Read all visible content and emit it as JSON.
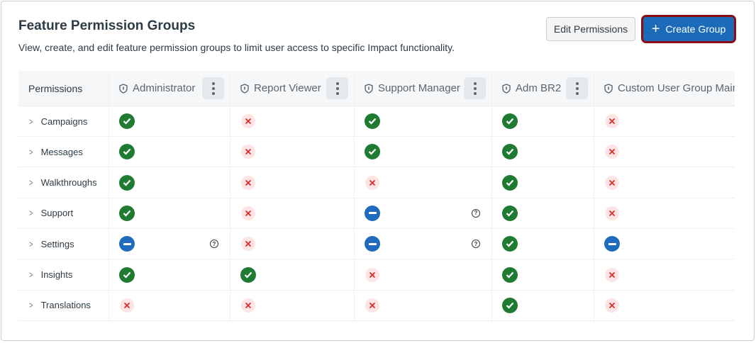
{
  "header": {
    "title": "Feature Permission Groups",
    "description": "View, create, and edit feature permission groups to limit user access to specific Impact functionality.",
    "edit_label": "Edit Permissions",
    "create_label": "Create Group",
    "create_icon": "+"
  },
  "table": {
    "first_header": "Permissions",
    "groups": [
      {
        "name": "Administrator",
        "menu": true
      },
      {
        "name": "Report Viewer",
        "menu": true
      },
      {
        "name": "Support Manager",
        "menu": true
      },
      {
        "name": "Adm BR2",
        "menu": true
      },
      {
        "name": "Custom User Group Maintenance",
        "menu": false
      }
    ],
    "rows": [
      {
        "label": "Campaigns",
        "status": [
          "check",
          "cross",
          "check",
          "check",
          "cross"
        ]
      },
      {
        "label": "Messages",
        "status": [
          "check",
          "cross",
          "check",
          "check",
          "cross"
        ]
      },
      {
        "label": "Walkthroughs",
        "status": [
          "check",
          "cross",
          "cross",
          "check",
          "cross"
        ]
      },
      {
        "label": "Support",
        "status": [
          "check",
          "cross",
          "partial",
          "check",
          "cross"
        ]
      },
      {
        "label": "Settings",
        "status": [
          "partial",
          "cross",
          "partial",
          "check",
          "partial"
        ]
      },
      {
        "label": "Insights",
        "status": [
          "check",
          "check",
          "cross",
          "check",
          "cross"
        ]
      },
      {
        "label": "Translations",
        "status": [
          "cross",
          "cross",
          "cross",
          "check",
          "cross"
        ]
      }
    ],
    "help_icon": "?"
  },
  "colors": {
    "check": "#1f7a32",
    "cross": "#d92d2a",
    "partial": "#1f6cbf",
    "primary": "#1b6bb8"
  }
}
